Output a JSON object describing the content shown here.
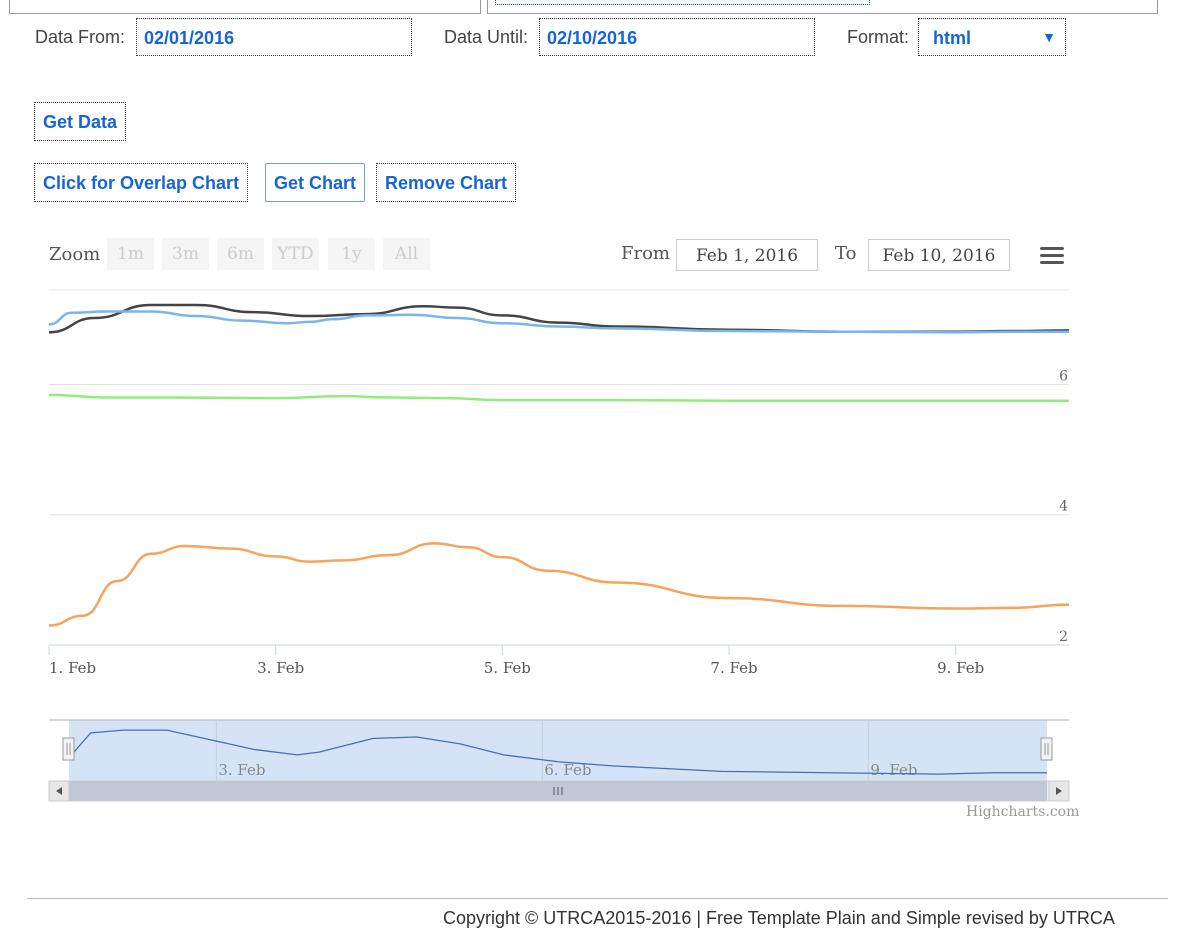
{
  "form": {
    "data_from_label": "Data From:",
    "data_from_value": "02/01/2016",
    "data_until_label": "Data Until:",
    "data_until_value": "02/10/2016",
    "format_label": "Format:",
    "format_value": "html"
  },
  "buttons": {
    "get_data": "Get Data",
    "overlap_chart": "Click for Overlap Chart",
    "get_chart": "Get Chart",
    "remove_chart": "Remove Chart"
  },
  "chart_toolbar": {
    "zoom_label": "Zoom",
    "zoom_buttons": [
      "1m",
      "3m",
      "6m",
      "YTD",
      "1y",
      "All"
    ],
    "from_label": "From",
    "from_value": "Feb 1, 2016",
    "to_label": "To",
    "to_value": "Feb 10, 2016",
    "menu_icon": "hamburger-menu-icon"
  },
  "chart_data": {
    "type": "line",
    "x_ticks": [
      "1. Feb",
      "3. Feb",
      "5. Feb",
      "7. Feb",
      "9. Feb"
    ],
    "y_ticks": [
      "6",
      "4",
      "2"
    ],
    "navigator_ticks": [
      "3. Feb",
      "6. Feb",
      "9. Feb"
    ],
    "credits": "Highcharts.com",
    "colors": {
      "dark": "#434348",
      "blue": "#7cb5ec",
      "green": "#90ed7d",
      "orange": "#f7a35c",
      "navigator_fill": "#d5e3f7",
      "navigator_line": "#4572a7"
    },
    "series": [
      {
        "color": "#434348",
        "x": [
          1.0,
          1.4,
          1.9,
          2.3,
          2.8,
          3.3,
          3.8,
          4.3,
          4.6,
          5.0,
          5.5,
          6.0,
          7.0,
          8.0,
          9.0,
          9.5,
          10.0
        ],
        "values": [
          6.8,
          7.02,
          7.22,
          7.22,
          7.11,
          7.05,
          7.08,
          7.2,
          7.18,
          7.06,
          6.95,
          6.89,
          6.84,
          6.81,
          6.81,
          6.82,
          6.83
        ]
      },
      {
        "color": "#7cb5ec",
        "x": [
          1.0,
          1.2,
          1.5,
          1.9,
          2.3,
          2.7,
          3.1,
          3.3,
          3.5,
          3.8,
          4.2,
          4.6,
          5.0,
          5.5,
          6.0,
          7.0,
          8.0,
          9.0,
          9.5,
          10.0
        ],
        "values": [
          6.92,
          7.1,
          7.12,
          7.12,
          7.05,
          6.98,
          6.94,
          6.96,
          7.0,
          7.06,
          7.07,
          7.02,
          6.94,
          6.89,
          6.86,
          6.82,
          6.81,
          6.8,
          6.81,
          6.81
        ]
      },
      {
        "color": "#90ed7d",
        "x": [
          1.0,
          1.5,
          2.0,
          3.0,
          3.6,
          4.0,
          4.5,
          5.0,
          6.0,
          7.0,
          8.0,
          9.0,
          10.0
        ],
        "values": [
          5.84,
          5.8,
          5.8,
          5.79,
          5.82,
          5.8,
          5.79,
          5.76,
          5.76,
          5.75,
          5.75,
          5.75,
          5.75
        ]
      },
      {
        "color": "#f7a35c",
        "x": [
          1.0,
          1.3,
          1.6,
          1.9,
          2.2,
          2.6,
          3.0,
          3.3,
          3.6,
          4.0,
          4.4,
          4.7,
          5.0,
          5.4,
          6.0,
          7.0,
          8.0,
          9.0,
          9.5,
          10.0
        ],
        "values": [
          2.3,
          2.45,
          2.98,
          3.4,
          3.52,
          3.48,
          3.36,
          3.28,
          3.3,
          3.38,
          3.56,
          3.5,
          3.35,
          3.14,
          2.96,
          2.72,
          2.6,
          2.56,
          2.57,
          2.62
        ]
      }
    ],
    "x_range": [
      1.0,
      10.0
    ],
    "y_range": [
      2.0,
      7.45
    ]
  },
  "footer": {
    "copyright": "Copyright © UTRCA2015-2016 | Free Template Plain and Simple revised by UTRCA"
  }
}
